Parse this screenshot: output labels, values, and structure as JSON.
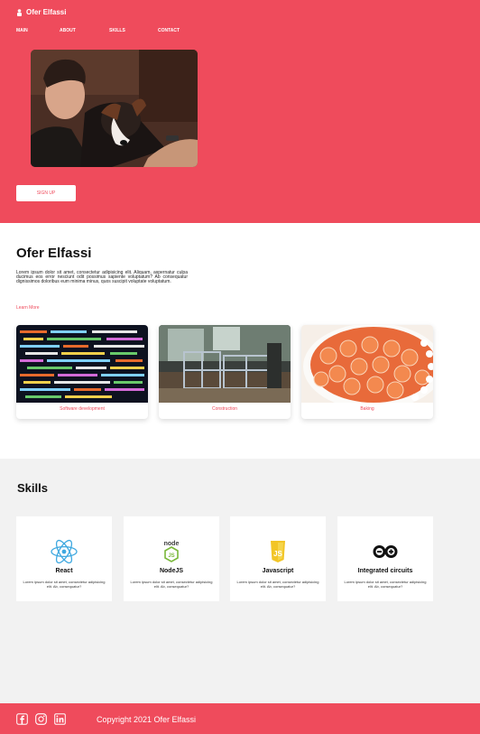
{
  "brand": {
    "name": "Ofer Elfassi",
    "logo_icon": "person-icon"
  },
  "nav": {
    "items": [
      "MAIN",
      "ABOUT",
      "SKILLS",
      "CONTACT"
    ]
  },
  "hero": {
    "signup_label": "SIGN UP"
  },
  "about": {
    "title": "Ofer Elfassi",
    "description": "Lorem ipsum dolor sit amet, consectetur adipisicing elit. Aliquam, aspernatur culpa ducimus eos error nesciunt odit possimus sapiente voluptatum? Ab consequatur dignissimos doloribus eum minima minus, quos suscipit voluptate voluptatum.",
    "learn_more": "Learn More",
    "cards": [
      {
        "caption": "Software development",
        "image": "code-screen-photo"
      },
      {
        "caption": "Construction",
        "image": "construction-site-photo"
      },
      {
        "caption": "Baking",
        "image": "strawberry-tart-photo"
      }
    ]
  },
  "skills": {
    "title": "Skills",
    "items": [
      {
        "name": "React",
        "icon": "react-icon",
        "text": "Lorem ipsum dolor sit amet, consectetur adipisicing elit. Ab, consequatur?"
      },
      {
        "name": "NodeJS",
        "icon": "nodejs-icon",
        "text": "Lorem ipsum dolor sit amet, consectetur adipisicing elit. Ab, consequatur?"
      },
      {
        "name": "Javascript",
        "icon": "javascript-icon",
        "text": "Lorem ipsum dolor sit amet, consectetur adipisicing elit. Ab, consequatur?"
      },
      {
        "name": "Integrated circuits",
        "icon": "arduino-icon",
        "text": "Lorem ipsum dolor sit amet, consectetur adipisicing elit. Ab, consequatur?"
      }
    ]
  },
  "footer": {
    "copyright": "Copyright 2021 Ofer Elfassi",
    "social": [
      "facebook-icon",
      "instagram-icon",
      "linkedin-icon"
    ]
  },
  "colors": {
    "accent": "#ef4b5c",
    "background": "#f2f2f2",
    "white": "#ffffff"
  }
}
